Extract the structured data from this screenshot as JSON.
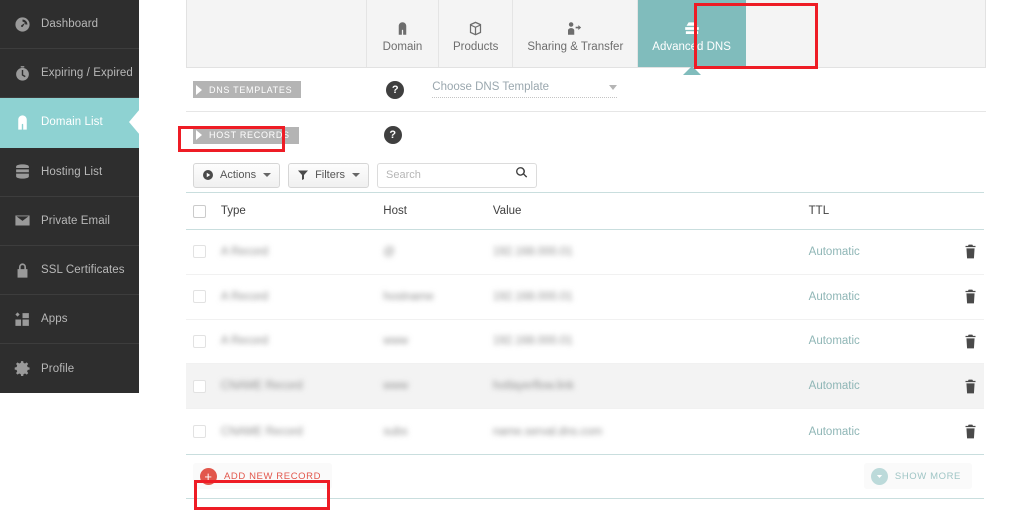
{
  "sidebar": {
    "items": [
      {
        "label": "Dashboard",
        "icon": "gauge-icon",
        "active": false
      },
      {
        "label": "Expiring / Expired",
        "icon": "clock-icon",
        "active": false
      },
      {
        "label": "Domain List",
        "icon": "home-icon",
        "active": true
      },
      {
        "label": "Hosting List",
        "icon": "server-icon",
        "active": false
      },
      {
        "label": "Private Email",
        "icon": "envelope-icon",
        "active": false
      },
      {
        "label": "SSL Certificates",
        "icon": "lock-icon",
        "active": false
      },
      {
        "label": "Apps",
        "icon": "apps-icon",
        "active": false
      },
      {
        "label": "Profile",
        "icon": "gear-icon",
        "active": false
      }
    ]
  },
  "tabs": [
    {
      "label": "Domain",
      "icon": "home-icon",
      "active": false
    },
    {
      "label": "Products",
      "icon": "box-icon",
      "active": false
    },
    {
      "label": "Sharing & Transfer",
      "icon": "transfer-icon",
      "active": false
    },
    {
      "label": "Advanced DNS",
      "icon": "dns-server-icon",
      "active": true
    }
  ],
  "sections": {
    "dns_templates": {
      "ribbon_label": "DNS TEMPLATES",
      "help": "?",
      "select_value": "Choose DNS Template"
    },
    "host_records": {
      "ribbon_label": "HOST RECORDS",
      "help": "?"
    }
  },
  "toolbar": {
    "actions_label": "Actions",
    "filters_label": "Filters",
    "search_placeholder": "Search",
    "search_value": ""
  },
  "table": {
    "columns": [
      "Type",
      "Host",
      "Value",
      "TTL"
    ],
    "rows": [
      {
        "type": "A Record",
        "host": "@",
        "value": "192.168.000.01",
        "ttl": "Automatic",
        "hover": false
      },
      {
        "type": "A Record",
        "host": "hostname",
        "value": "192.168.000.01",
        "ttl": "Automatic",
        "hover": false
      },
      {
        "type": "A Record",
        "host": "www",
        "value": "192.168.000.01",
        "ttl": "Automatic",
        "hover": false
      },
      {
        "type": "CNAME Record",
        "host": "www",
        "value": "hotlayerflow.link",
        "ttl": "Automatic",
        "hover": true
      },
      {
        "type": "CNAME Record",
        "host": "subs",
        "value": "name.serval.dns.com",
        "ttl": "Automatic",
        "hover": false
      }
    ]
  },
  "footer": {
    "add_record_label": "ADD NEW RECORD",
    "show_more_label": "SHOW MORE"
  },
  "colors": {
    "accent_teal": "#80bcbc",
    "sidebar_bg": "#2e2e2e",
    "annotation_red": "#ee1c25",
    "add_record_red": "#e2574c"
  }
}
